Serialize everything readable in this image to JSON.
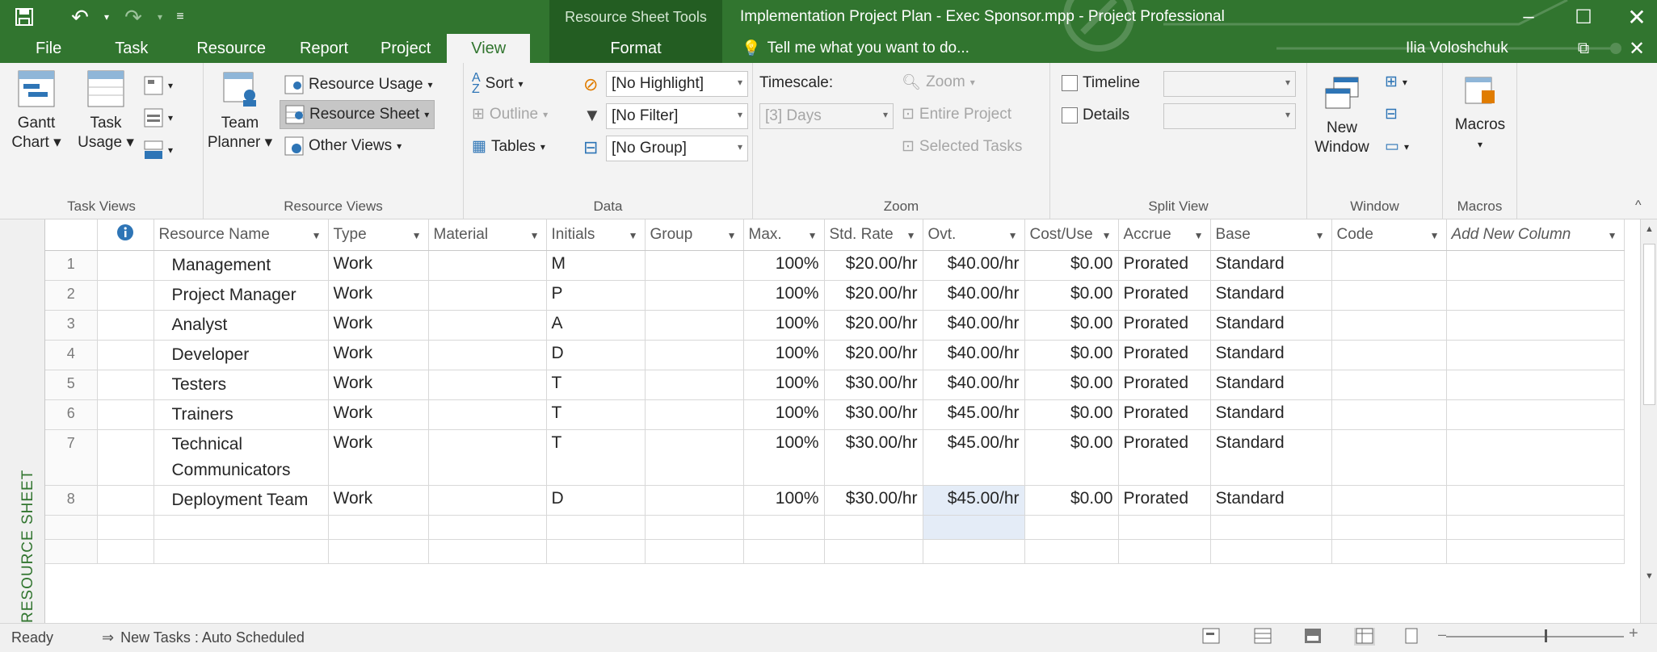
{
  "window": {
    "title": "Implementation Project Plan - Exec Sponsor.mpp - Project Professional",
    "contextual_group": "Resource Sheet Tools",
    "contextual_tab": "Format",
    "user": "Ilia Voloshchuk",
    "tell_me": "Tell me what you want to do..."
  },
  "tabs": [
    "File",
    "Task",
    "Resource",
    "Report",
    "Project",
    "View"
  ],
  "active_tab": "View",
  "ribbon": {
    "task_views": {
      "label": "Task Views",
      "gantt": "Gantt Chart",
      "gantt2": "Chart ▾",
      "gantt1": "Gantt",
      "usage1": "Task",
      "usage2": "Usage ▾"
    },
    "resource_views": {
      "label": "Resource Views",
      "team1": "Team",
      "team2": "Planner ▾",
      "usage": "Resource Usage",
      "sheet": "Resource Sheet",
      "other": "Other Views"
    },
    "data": {
      "label": "Data",
      "sort": "Sort",
      "outline": "Outline",
      "tables": "Tables",
      "highlight": "[No Highlight]",
      "filter": "[No Filter]",
      "group": "[No Group]"
    },
    "zoom": {
      "label": "Zoom",
      "timescale": "Timescale:",
      "timescale_value": "[3] Days",
      "zoom": "Zoom",
      "entire": "Entire Project",
      "selected": "Selected Tasks"
    },
    "split": {
      "label": "Split View",
      "timeline": "Timeline",
      "details": "Details"
    },
    "window": {
      "label": "Window",
      "new1": "New",
      "new2": "Window"
    },
    "macros": {
      "label": "Macros",
      "macros": "Macros"
    }
  },
  "side_label": "RESOURCE SHEET",
  "columns": [
    "Resource Name",
    "Type",
    "Material",
    "Initials",
    "Group",
    "Max.",
    "Std. Rate",
    "Ovt.",
    "Cost/Use",
    "Accrue",
    "Base",
    "Code",
    "Add New Column"
  ],
  "rows": [
    {
      "id": "1",
      "name": "Management",
      "type": "Work",
      "material": "",
      "initials": "M",
      "group": "",
      "max": "100%",
      "std": "$20.00/hr",
      "ovt": "$40.00/hr",
      "cost": "$0.00",
      "accrue": "Prorated",
      "base": "Standard",
      "code": ""
    },
    {
      "id": "2",
      "name": "Project Manager",
      "type": "Work",
      "material": "",
      "initials": "P",
      "group": "",
      "max": "100%",
      "std": "$20.00/hr",
      "ovt": "$40.00/hr",
      "cost": "$0.00",
      "accrue": "Prorated",
      "base": "Standard",
      "code": ""
    },
    {
      "id": "3",
      "name": "Analyst",
      "type": "Work",
      "material": "",
      "initials": "A",
      "group": "",
      "max": "100%",
      "std": "$20.00/hr",
      "ovt": "$40.00/hr",
      "cost": "$0.00",
      "accrue": "Prorated",
      "base": "Standard",
      "code": ""
    },
    {
      "id": "4",
      "name": "Developer",
      "type": "Work",
      "material": "",
      "initials": "D",
      "group": "",
      "max": "100%",
      "std": "$20.00/hr",
      "ovt": "$40.00/hr",
      "cost": "$0.00",
      "accrue": "Prorated",
      "base": "Standard",
      "code": ""
    },
    {
      "id": "5",
      "name": "Testers",
      "type": "Work",
      "material": "",
      "initials": "T",
      "group": "",
      "max": "100%",
      "std": "$30.00/hr",
      "ovt": "$40.00/hr",
      "cost": "$0.00",
      "accrue": "Prorated",
      "base": "Standard",
      "code": ""
    },
    {
      "id": "6",
      "name": "Trainers",
      "type": "Work",
      "material": "",
      "initials": "T",
      "group": "",
      "max": "100%",
      "std": "$30.00/hr",
      "ovt": "$45.00/hr",
      "cost": "$0.00",
      "accrue": "Prorated",
      "base": "Standard",
      "code": ""
    },
    {
      "id": "7",
      "name": "Technical Communicators",
      "type": "Work",
      "material": "",
      "initials": "T",
      "group": "",
      "max": "100%",
      "std": "$30.00/hr",
      "ovt": "$45.00/hr",
      "cost": "$0.00",
      "accrue": "Prorated",
      "base": "Standard",
      "code": ""
    },
    {
      "id": "8",
      "name": "Deployment Team",
      "type": "Work",
      "material": "",
      "initials": "D",
      "group": "",
      "max": "100%",
      "std": "$30.00/hr",
      "ovt": "$45.00/hr",
      "cost": "$0.00",
      "accrue": "Prorated",
      "base": "Standard",
      "code": ""
    }
  ],
  "status": {
    "ready": "Ready",
    "new_tasks": "New Tasks : Auto Scheduled"
  },
  "colors": {
    "brand": "#31752f",
    "contextual": "#235d22",
    "selected_cell": "#e4ecf7"
  }
}
